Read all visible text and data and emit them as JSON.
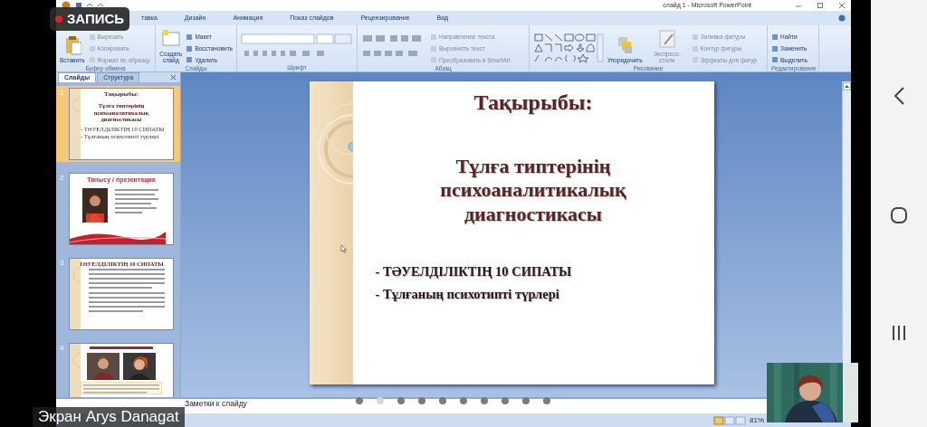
{
  "recording_badge": {
    "label": "ЗАПИСЬ"
  },
  "window": {
    "title": "слайд 1 - Microsoft PowerPoint"
  },
  "ribbon_tabs": [
    {
      "label": "тавка",
      "selected": false
    },
    {
      "label": "Дизайн",
      "selected": false
    },
    {
      "label": "Анимация",
      "selected": false
    },
    {
      "label": "Показ слайдов",
      "selected": false
    },
    {
      "label": "Рецензирование",
      "selected": false
    },
    {
      "label": "Вид",
      "selected": false
    }
  ],
  "ribbon_groups": [
    {
      "label": "Буфер обмена",
      "columns": [
        [
          {
            "kind": "large",
            "label": "Вставить",
            "disabled": false
          }
        ],
        [
          {
            "kind": "small",
            "label": "Вырезать",
            "disabled": true
          },
          {
            "kind": "small",
            "label": "Копировать",
            "disabled": true
          },
          {
            "kind": "small",
            "label": "Формат по образцу",
            "disabled": true
          }
        ]
      ]
    },
    {
      "label": "Слайды",
      "columns": [
        [
          {
            "kind": "large",
            "label": "Создать слайд",
            "disabled": false
          }
        ],
        [
          {
            "kind": "small",
            "label": "Макет",
            "disabled": false
          },
          {
            "kind": "small",
            "label": "Восстановить",
            "disabled": false
          },
          {
            "kind": "small",
            "label": "Удалить",
            "disabled": false
          }
        ]
      ]
    },
    {
      "label": "Шрифт",
      "columns": [
        [
          {
            "kind": "font-controls"
          }
        ]
      ]
    },
    {
      "label": "Абзац",
      "columns": [
        [
          {
            "kind": "paragraph-controls"
          }
        ],
        [
          {
            "kind": "small",
            "label": "Направление текста",
            "disabled": true
          },
          {
            "kind": "small",
            "label": "Выровнять текст",
            "disabled": true
          },
          {
            "kind": "small",
            "label": "Преобразовать в SmartArt",
            "disabled": true
          }
        ]
      ]
    },
    {
      "label": "Рисование",
      "columns": [
        [
          {
            "kind": "shapes-gallery"
          }
        ],
        [
          {
            "kind": "large",
            "label": "Упорядочить",
            "disabled": false
          }
        ],
        [
          {
            "kind": "large",
            "label": "Экспресс-стили",
            "disabled": true
          }
        ],
        [
          {
            "kind": "small",
            "label": "Заливка фигуры",
            "disabled": true
          },
          {
            "kind": "small",
            "label": "Контур фигуры",
            "disabled": true
          },
          {
            "kind": "small",
            "label": "Эффекты для фигур",
            "disabled": true
          }
        ]
      ]
    },
    {
      "label": "Редактирование",
      "columns": [
        [
          {
            "kind": "small",
            "label": "Найти",
            "disabled": false
          },
          {
            "kind": "small",
            "label": "Заменить",
            "disabled": false
          },
          {
            "kind": "small",
            "label": "Выделить",
            "disabled": false
          }
        ]
      ]
    }
  ],
  "panel_tabs": [
    {
      "label": "Слайды",
      "selected": true
    },
    {
      "label": "Структура",
      "selected": false
    }
  ],
  "thumbnails": [
    {
      "number": "1",
      "selected": true,
      "kind": "title",
      "title": "Тақырыбы:",
      "lines": [
        "Тұлға типтерінің",
        "психоаналитикалық",
        "диагностикасы"
      ],
      "bullets": [
        "- ТӘУЕЛДІЛІКТІҢ 10 СИПАТЫ",
        "- Тұлғаның психотипті түрлері"
      ]
    },
    {
      "number": "2",
      "selected": false,
      "kind": "photo-text",
      "title": "Танысу / презентация"
    },
    {
      "number": "3",
      "selected": false,
      "kind": "text",
      "title": "ТӘУЕЛДІЛІКТІҢ 10 СИПАТЫ"
    },
    {
      "number": "4",
      "selected": false,
      "kind": "photos"
    }
  ],
  "slide": {
    "title": "Тақырыбы:",
    "heading_lines": [
      "Тұлға типтерінің",
      "психоаналитикалық",
      "диагностикасы"
    ],
    "bullets": [
      "- ТӘУЕЛДІЛІКТІҢ 10 СИПАТЫ",
      "- Тұлғаның психотипті түрлері"
    ]
  },
  "notes": {
    "placeholder": "Заметки к слайду"
  },
  "page_dots": [
    {
      "selected": false
    },
    {
      "selected": true
    },
    {
      "selected": false
    },
    {
      "selected": false
    },
    {
      "selected": false
    },
    {
      "selected": false
    },
    {
      "selected": false
    },
    {
      "selected": false
    },
    {
      "selected": false
    },
    {
      "selected": false
    }
  ],
  "status_bar": {
    "zoom": "81%"
  },
  "presenter": {
    "label": "Экран Arys Danagat"
  }
}
